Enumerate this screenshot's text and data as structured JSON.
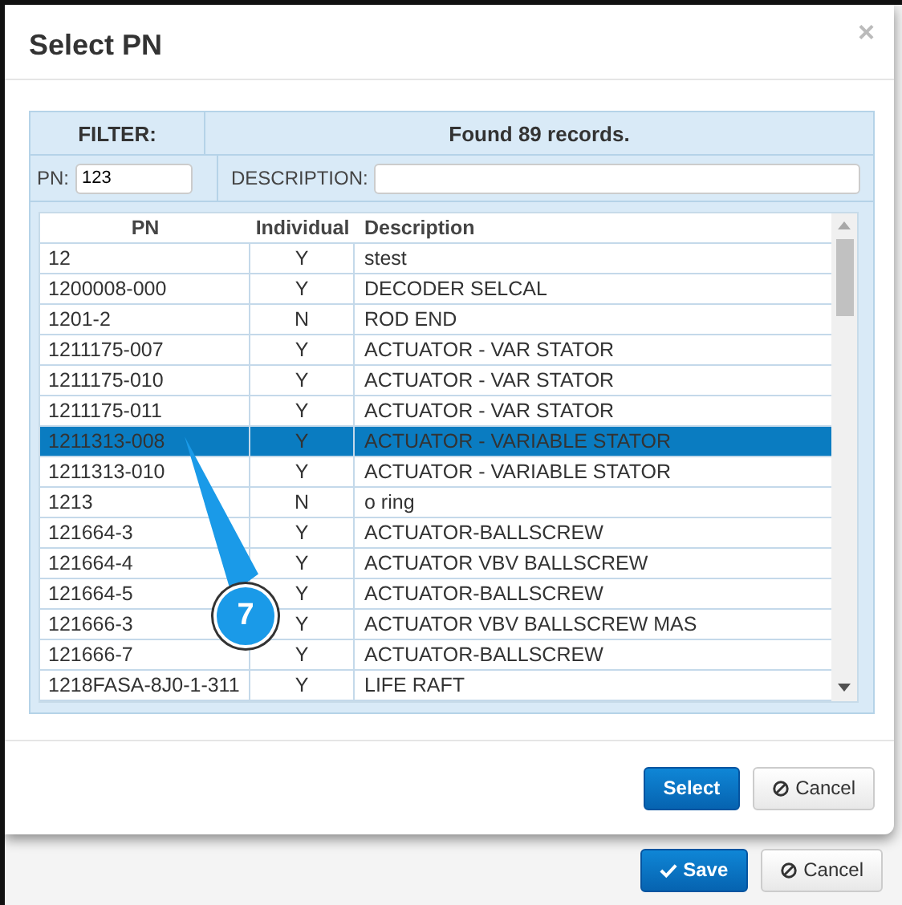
{
  "dialog": {
    "title": "Select PN",
    "close": "×",
    "filter": {
      "heading": "FILTER:",
      "result": "Found 89 records.",
      "pn_label": "PN:",
      "pn_value": "123",
      "description_label": "DESCRIPTION:"
    },
    "table": {
      "columns": [
        "PN",
        "Individual",
        "Description"
      ],
      "rows": [
        {
          "pn": "12",
          "individual": "Y",
          "description": "stest",
          "selected": false
        },
        {
          "pn": "1200008-000",
          "individual": "Y",
          "description": "DECODER SELCAL",
          "selected": false
        },
        {
          "pn": "1201-2",
          "individual": "N",
          "description": "ROD END",
          "selected": false
        },
        {
          "pn": "1211175-007",
          "individual": "Y",
          "description": "ACTUATOR - VAR STATOR",
          "selected": false
        },
        {
          "pn": "1211175-010",
          "individual": "Y",
          "description": "ACTUATOR - VAR STATOR",
          "selected": false
        },
        {
          "pn": "1211175-011",
          "individual": "Y",
          "description": "ACTUATOR - VAR STATOR",
          "selected": false
        },
        {
          "pn": "1211313-008",
          "individual": "Y",
          "description": "ACTUATOR - VARIABLE STATOR",
          "selected": true
        },
        {
          "pn": "1211313-010",
          "individual": "Y",
          "description": "ACTUATOR - VARIABLE STATOR",
          "selected": false
        },
        {
          "pn": "1213",
          "individual": "N",
          "description": "o ring",
          "selected": false
        },
        {
          "pn": "121664-3",
          "individual": "Y",
          "description": "ACTUATOR-BALLSCREW",
          "selected": false
        },
        {
          "pn": "121664-4",
          "individual": "Y",
          "description": "ACTUATOR VBV BALLSCREW",
          "selected": false
        },
        {
          "pn": "121664-5",
          "individual": "Y",
          "description": "ACTUATOR-BALLSCREW",
          "selected": false
        },
        {
          "pn": "121666-3",
          "individual": "Y",
          "description": "ACTUATOR VBV BALLSCREW MAS",
          "selected": false
        },
        {
          "pn": "121666-7",
          "individual": "Y",
          "description": "ACTUATOR-BALLSCREW",
          "selected": false
        },
        {
          "pn": "1218FASA-8J0-1-311",
          "individual": "Y",
          "description": "LIFE RAFT",
          "selected": false
        }
      ]
    },
    "buttons": [
      {
        "label": "Select",
        "kind": "primary"
      },
      {
        "label": "Cancel",
        "kind": "cancel"
      }
    ]
  },
  "callout": {
    "number": "7"
  },
  "page_buttons": [
    {
      "label": "Save",
      "kind": "save"
    },
    {
      "label": "Cancel",
      "kind": "cancel"
    }
  ]
}
